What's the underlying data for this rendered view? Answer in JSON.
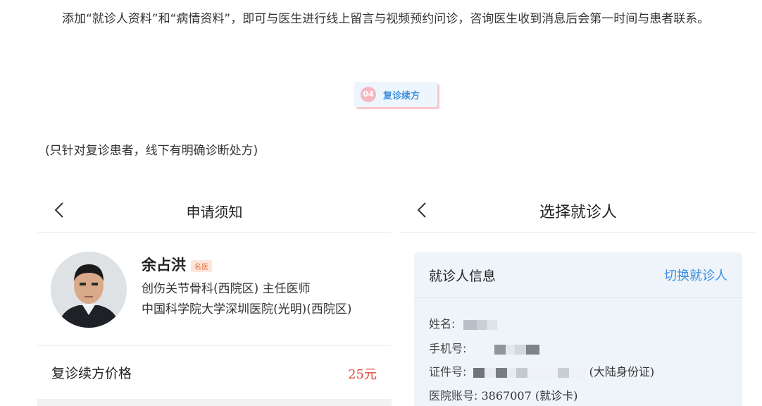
{
  "intro_text": "添加“就诊人资料”和“病情资料”，即可与医生进行线上留言与视频预约问诊，咨询医生收到消息后会第一时间与患者联系。",
  "step": {
    "number": "04",
    "label": "复诊续方"
  },
  "note": "(只针对复诊患者，线下有明确诊断处方)",
  "left_screen": {
    "title": "申请须知",
    "doctor": {
      "name": "余占洪",
      "tag": "名医",
      "dept": "创伤关节骨科(西院区) 主任医师",
      "hospital": "中国科学院大学深圳医院(光明)(西院区)"
    },
    "price_label": "复诊续方价格",
    "price_value": "25元"
  },
  "right_screen": {
    "title": "选择就诊人",
    "card_title": "就诊人信息",
    "switch_label": "切换就诊人",
    "name_label": "姓名:",
    "phone_label": "手机号:",
    "id_label": "证件号:",
    "id_type": "(大陆身份证)",
    "account_label": "医院账号:",
    "account_value": "3867007 (就诊卡)"
  },
  "colors": {
    "accent": "#3c8de0",
    "price": "#e0493c",
    "tag": "#e9703b"
  }
}
